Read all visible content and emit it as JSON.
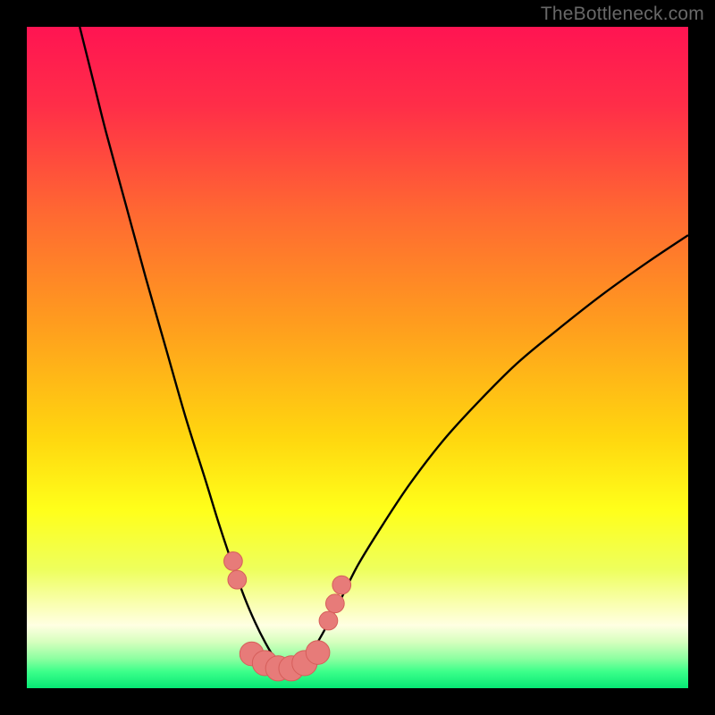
{
  "watermark": "TheBottleneck.com",
  "colors": {
    "frame": "#000000",
    "curve": "#000000",
    "marker_fill": "#e77b79",
    "marker_stroke": "#d65e5a",
    "gradient_stops": [
      {
        "offset": 0.0,
        "color": "#ff1452"
      },
      {
        "offset": 0.12,
        "color": "#ff2e48"
      },
      {
        "offset": 0.28,
        "color": "#ff6832"
      },
      {
        "offset": 0.45,
        "color": "#ff9d1e"
      },
      {
        "offset": 0.62,
        "color": "#ffd60f"
      },
      {
        "offset": 0.73,
        "color": "#ffff1a"
      },
      {
        "offset": 0.82,
        "color": "#eeff5c"
      },
      {
        "offset": 0.875,
        "color": "#faffb4"
      },
      {
        "offset": 0.905,
        "color": "#ffffe2"
      },
      {
        "offset": 0.93,
        "color": "#d6ffbe"
      },
      {
        "offset": 0.955,
        "color": "#8effa1"
      },
      {
        "offset": 0.975,
        "color": "#3cff8a"
      },
      {
        "offset": 1.0,
        "color": "#06e874"
      }
    ]
  },
  "chart_data": {
    "type": "line",
    "title": "",
    "xlabel": "",
    "ylabel": "",
    "xlim": [
      0,
      100
    ],
    "ylim": [
      0,
      100
    ],
    "grid": false,
    "legend": false,
    "series": [
      {
        "name": "bottleneck-curve",
        "x": [
          8,
          10,
          12,
          15,
          18,
          21,
          24,
          27,
          29,
          31,
          33,
          34.5,
          36,
          37.5,
          39,
          40.5,
          42,
          44,
          47,
          50,
          54,
          58,
          63,
          68,
          74,
          80,
          87,
          94,
          100
        ],
        "y": [
          100,
          92,
          84,
          73,
          62,
          51.5,
          41,
          31.5,
          25,
          19,
          13.5,
          10,
          7,
          4.5,
          3,
          3,
          4,
          7,
          12.5,
          18.5,
          25,
          31,
          37.5,
          43,
          49,
          54,
          59.5,
          64.5,
          68.5
        ]
      }
    ],
    "markers": [
      {
        "x": 31.2,
        "y": 19.2,
        "r": 1.4
      },
      {
        "x": 31.8,
        "y": 16.4,
        "r": 1.4
      },
      {
        "x": 34.0,
        "y": 5.2,
        "r": 1.8
      },
      {
        "x": 36.0,
        "y": 3.8,
        "r": 1.9
      },
      {
        "x": 38.0,
        "y": 3.0,
        "r": 1.9
      },
      {
        "x": 40.0,
        "y": 3.0,
        "r": 1.9
      },
      {
        "x": 42.0,
        "y": 3.8,
        "r": 1.9
      },
      {
        "x": 44.0,
        "y": 5.4,
        "r": 1.8
      },
      {
        "x": 45.6,
        "y": 10.2,
        "r": 1.4
      },
      {
        "x": 46.6,
        "y": 12.8,
        "r": 1.4
      },
      {
        "x": 47.6,
        "y": 15.6,
        "r": 1.4
      }
    ],
    "optimum_x": 39
  }
}
